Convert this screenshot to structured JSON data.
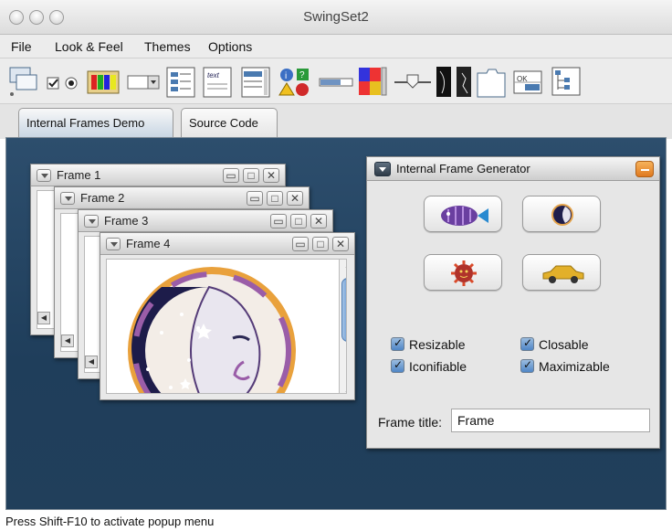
{
  "window": {
    "title": "SwingSet2"
  },
  "menubar": {
    "items": [
      "File",
      "Look & Feel",
      "Themes",
      "Options"
    ]
  },
  "toolbar": {
    "items": [
      "internal-frames-icon",
      "checkbox-radio-icon",
      "color-chooser-icon",
      "combobox-icon",
      "file-chooser-icon",
      "html-editor-icon",
      "list-icon",
      "option-pane-icon",
      "progress-bar-icon",
      "scroll-pane-icon",
      "slider-icon",
      "split-pane-icon",
      "tabbed-pane-icon",
      "table-icon",
      "tooltip-icon",
      "tree-icon"
    ]
  },
  "tabs": [
    {
      "label": "Internal Frames Demo",
      "selected": true
    },
    {
      "label": "Source Code",
      "selected": false
    }
  ],
  "frames": [
    {
      "title": "Frame 1"
    },
    {
      "title": "Frame 2"
    },
    {
      "title": "Frame 3"
    },
    {
      "title": "Frame 4"
    }
  ],
  "generator": {
    "title": "Internal Frame Generator",
    "buttons": [
      "fish-image-button",
      "moon-image-button",
      "sun-image-button",
      "cab-image-button"
    ],
    "checkboxes": [
      {
        "label": "Resizable",
        "checked": true
      },
      {
        "label": "Closable",
        "checked": true
      },
      {
        "label": "Iconifiable",
        "checked": true
      },
      {
        "label": "Maximizable",
        "checked": true
      }
    ],
    "frame_title_label": "Frame title:",
    "frame_title_value": "Frame"
  },
  "status": {
    "text": "Press Shift-F10 to activate popup menu"
  },
  "colors": {
    "desktop": "#25445f",
    "accent_min": "#e8892c",
    "checkbox": "#4f86c6"
  }
}
